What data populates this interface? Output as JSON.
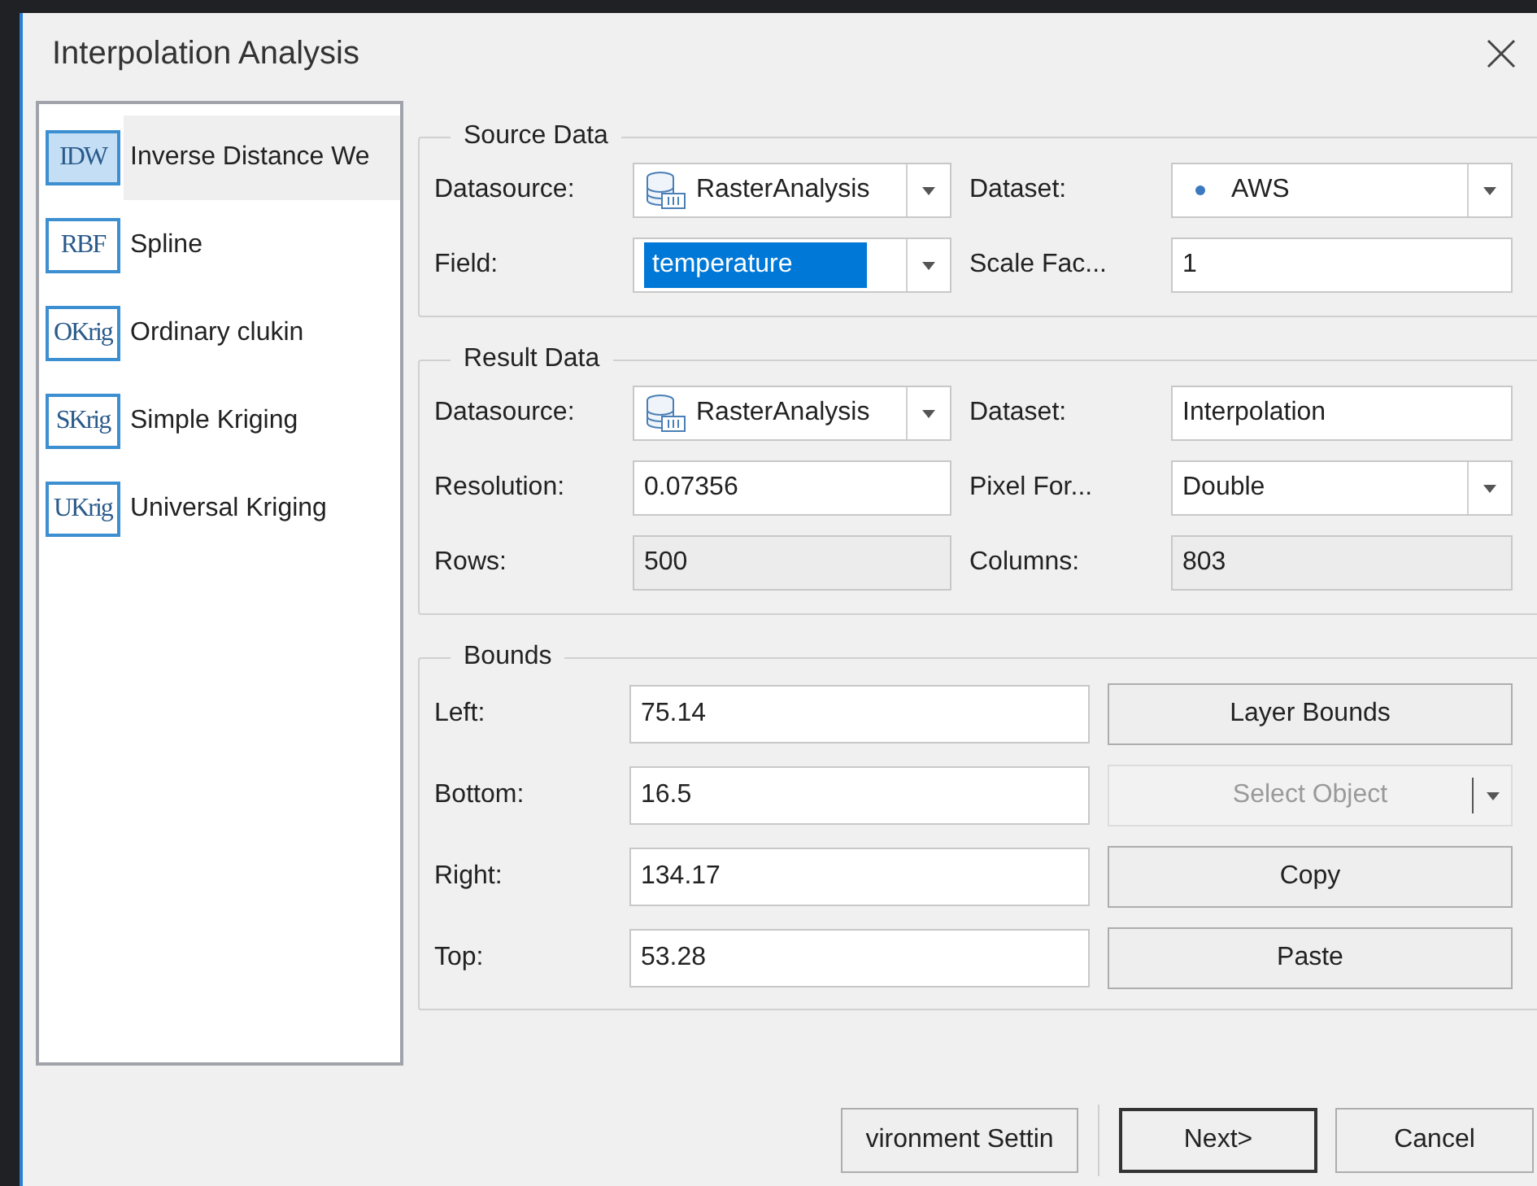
{
  "window": {
    "title": "Interpolation Analysis"
  },
  "methods": [
    {
      "icon_text": "IDW",
      "label": "Inverse Distance We",
      "selected": true
    },
    {
      "icon_text": "RBF",
      "label": "Spline",
      "selected": false
    },
    {
      "icon_text": "OKrig",
      "label": "Ordinary clukin",
      "selected": false
    },
    {
      "icon_text": "SKrig",
      "label": "Simple Kriging",
      "selected": false
    },
    {
      "icon_text": "UKrig",
      "label": "Universal Kriging",
      "selected": false
    }
  ],
  "sections": [
    {
      "title": "Source Data",
      "rows": [
        [
          {
            "label": "Datasource:",
            "value": "RasterAnalysis",
            "kind": "datasource_combo",
            "highlighted": false
          },
          {
            "label": "Dataset:",
            "value": "AWS",
            "kind": "dataset_combo",
            "highlighted": false
          }
        ],
        [
          {
            "label": "Field:",
            "value": "temperature",
            "kind": "combo",
            "highlighted": true
          },
          {
            "label": "Scale Fac...",
            "value": "1",
            "kind": "text",
            "highlighted": false
          }
        ]
      ]
    },
    {
      "title": "Result Data",
      "rows": [
        [
          {
            "label": "Datasource:",
            "value": "RasterAnalysis",
            "kind": "datasource_combo",
            "highlighted": false
          },
          {
            "label": "Dataset:",
            "value": "Interpolation",
            "kind": "text",
            "highlighted": false
          }
        ],
        [
          {
            "label": "Resolution:",
            "value": "0.07356",
            "kind": "text",
            "highlighted": false
          },
          {
            "label": "Pixel For...",
            "value": "Double",
            "kind": "combo",
            "highlighted": false
          }
        ],
        [
          {
            "label": "Rows:",
            "value": "500",
            "kind": "readonly",
            "highlighted": false
          },
          {
            "label": "Columns:",
            "value": "803",
            "kind": "readonly",
            "highlighted": false
          }
        ]
      ]
    }
  ],
  "bounds": {
    "title": "Bounds",
    "rows": [
      {
        "label": "Left:",
        "value": "75.14",
        "button": {
          "label": "Layer Bounds",
          "kind": "plain",
          "disabled": false
        }
      },
      {
        "label": "Bottom:",
        "value": "16.5",
        "button": {
          "label": "Select Object",
          "kind": "split",
          "disabled": true
        }
      },
      {
        "label": "Right:",
        "value": "134.17",
        "button": {
          "label": "Copy",
          "kind": "plain",
          "disabled": false
        }
      },
      {
        "label": "Top:",
        "value": "53.28",
        "button": {
          "label": "Paste",
          "kind": "plain",
          "disabled": false
        }
      }
    ]
  },
  "footer": [
    {
      "label": "vironment Settin",
      "default": false,
      "separator_after": true
    },
    {
      "label": "Next>",
      "default": true,
      "separator_after": false
    },
    {
      "label": "Cancel",
      "default": false,
      "separator_after": false
    }
  ]
}
